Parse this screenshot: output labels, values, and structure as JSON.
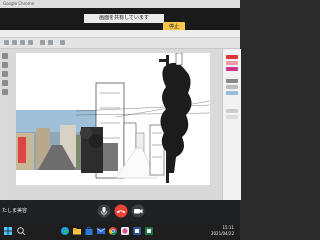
{
  "browser": {
    "title": "Google Chrome"
  },
  "share_banner": {
    "message": "画面を共有しています",
    "stop_label": "停止"
  },
  "meeting": {
    "participant_name": "たしま美容"
  },
  "taskbar": {
    "time": "15:11",
    "date": "2021/04/22"
  },
  "colors": {
    "hangup": "#ea4335",
    "stop_button": "#f6c74a",
    "banner_bg": "#1a1a1a"
  }
}
